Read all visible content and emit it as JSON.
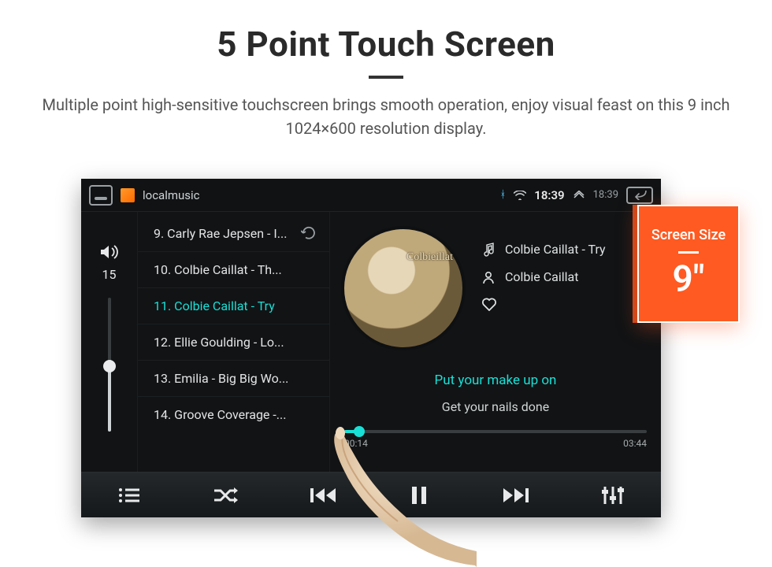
{
  "page": {
    "title": "5 Point Touch Screen",
    "subtitle": "Multiple point high-sensitive touchscreen brings smooth operation, enjoy visual feast on this 9 inch 1024×600 resolution display."
  },
  "badge": {
    "label": "Screen Size",
    "value": "9\""
  },
  "statusbar": {
    "app_label": "localmusic",
    "time_primary": "18:39",
    "time_secondary": "18:39"
  },
  "volume": {
    "level": "15"
  },
  "playlist": {
    "items": [
      {
        "label": "9. Carly Rae Jepsen - I..."
      },
      {
        "label": "10. Colbie Caillat - Th..."
      },
      {
        "label": "11. Colbie Caillat - Try"
      },
      {
        "label": "12. Ellie Goulding - Lo..."
      },
      {
        "label": "13. Emilia - Big Big Wo..."
      },
      {
        "label": "14. Groove Coverage -..."
      }
    ],
    "active_index": 2
  },
  "now_playing": {
    "title": "Colbie Caillat - Try",
    "artist": "Colbie Caillat",
    "lyric_current": "Put your make up on",
    "lyric_next": "Get your nails done",
    "elapsed": "00:14",
    "total": "03:44"
  }
}
